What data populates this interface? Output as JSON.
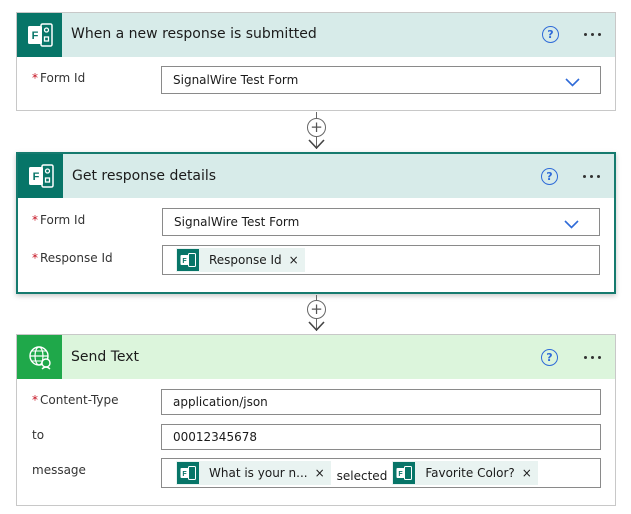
{
  "trigger_card": {
    "title": "When a new response is submitted",
    "logo_icon": "microsoft-forms-icon",
    "fields": [
      {
        "label": "Form Id",
        "required": "*",
        "value": "SignalWire Test Form"
      }
    ]
  },
  "get_response_card": {
    "title": "Get response details",
    "logo_icon": "microsoft-forms-icon",
    "fields": [
      {
        "label": "Form Id",
        "required": "*",
        "value": "SignalWire Test Form"
      },
      {
        "label": "Response Id",
        "required": "*",
        "token": "Response Id",
        "remove": "×"
      }
    ]
  },
  "send_text_card": {
    "title": "Send Text",
    "logo_icon": "globe-icon",
    "fields": [
      {
        "label": "Content-Type",
        "required": "*",
        "value": "application/json"
      },
      {
        "label": "to",
        "value": "00012345678"
      },
      {
        "label": "message",
        "token1": "What is your n...",
        "joiner": "selected",
        "token2": "Favorite Color?",
        "remove": "×"
      }
    ]
  },
  "icons": {
    "help": "?",
    "add": "+"
  },
  "colors": {
    "forms_brand": "#077568",
    "forms_header_bg": "#d7ebe9",
    "send_text_brand": "#1fa84a",
    "send_text_header_bg": "#dcf5dc",
    "help_blue": "#2f6bd8",
    "selected_border": "#157a6e"
  }
}
